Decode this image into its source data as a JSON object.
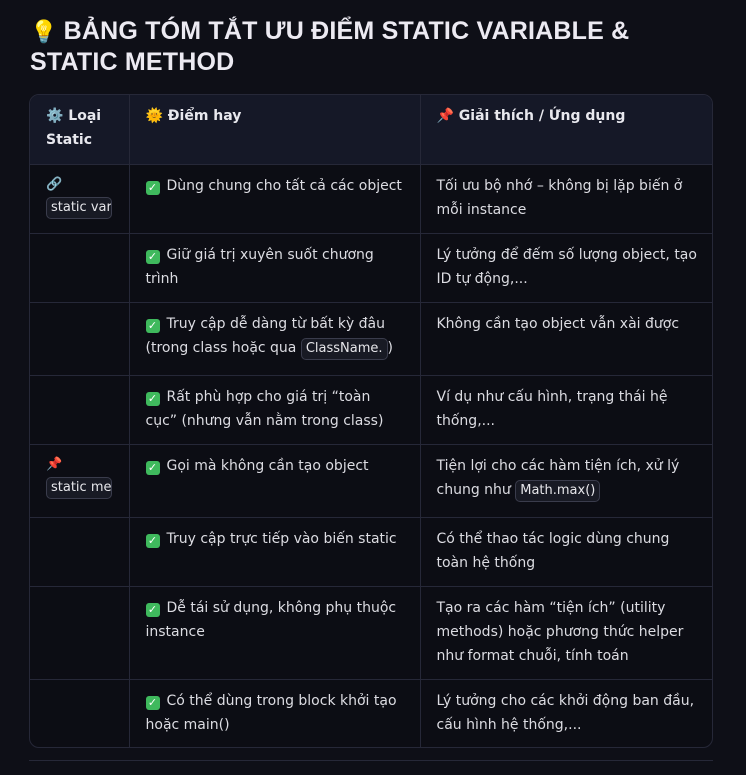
{
  "title": "BẢNG TÓM TẮT ƯU ĐIỂM STATIC VARIABLE & STATIC METHOD",
  "title_icon": "lightbulb-icon",
  "headers": {
    "col1": "⚙️ Loại Static",
    "col2": "🌞 Điểm hay",
    "col3": "📌 Giải thích / Ứng dụng"
  },
  "rows": [
    {
      "type_icon": "🔗",
      "type_code": "static variable",
      "point": "Dùng chung cho tất cả các object",
      "explain": "Tối ưu bộ nhớ – không bị lặp biến ở mỗi instance"
    },
    {
      "type_icon": "",
      "type_code": "",
      "point": "Giữ giá trị xuyên suốt chương trình",
      "explain": "Lý tưởng để đếm số lượng object, tạo ID tự động,..."
    },
    {
      "type_icon": "",
      "type_code": "",
      "point": "Truy cập dễ dàng từ bất kỳ đâu (trong class hoặc qua",
      "point_code": "ClassName.",
      "point_after": ")",
      "explain": "Không cần tạo object vẫn xài được"
    },
    {
      "type_icon": "",
      "type_code": "",
      "point": "Rất phù hợp cho giá trị “toàn cục” (nhưng vẫn nằm trong class)",
      "explain": "Ví dụ như cấu hình, trạng thái hệ thống,..."
    },
    {
      "type_icon": "📌",
      "type_code": "static method",
      "point": "Gọi mà không cần tạo object",
      "explain": "Tiện lợi cho các hàm tiện ích, xử lý chung như",
      "explain_code": "Math.max()"
    },
    {
      "type_icon": "",
      "type_code": "",
      "point": "Truy cập trực tiếp vào biến static",
      "explain": "Có thể thao tác logic dùng chung toàn hệ thống"
    },
    {
      "type_icon": "",
      "type_code": "",
      "point": "Dễ tái sử dụng, không phụ thuộc instance",
      "explain": "Tạo ra các hàm “tiện ích” (utility methods) hoặc phương thức helper như format chuỗi, tính toán"
    },
    {
      "type_icon": "",
      "type_code": "",
      "point": "Có thể dùng trong block khởi tạo hoặc main()",
      "explain": "Lý tưởng cho các khởi động ban đầu, cấu hình hệ thống,..."
    }
  ],
  "colors": {
    "check": "#3fb95d",
    "header_bg": "#151827",
    "border": "#262838"
  }
}
